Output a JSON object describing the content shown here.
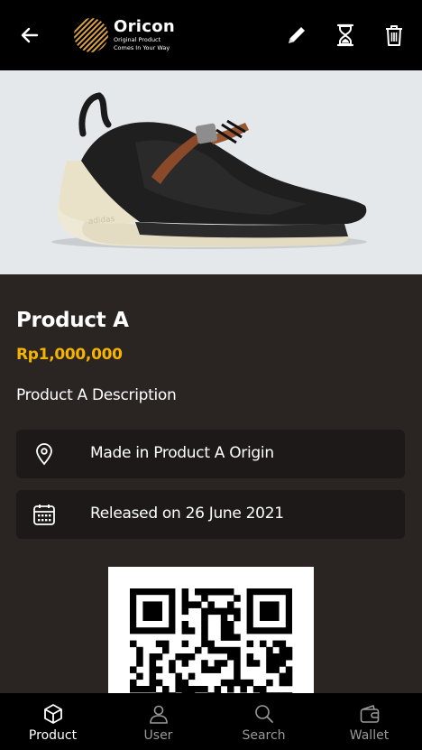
{
  "header": {
    "brand_name": "Oricon",
    "brand_tagline_1": "Original Product",
    "brand_tagline_2": "Comes In Your Way"
  },
  "product": {
    "name": "Product A",
    "price": "Rp1,000,000",
    "description": "Product A Description",
    "origin_text": "Made in Product A Origin",
    "release_text": "Released on 26 June 2021"
  },
  "nav": {
    "items": [
      {
        "label": "Product",
        "icon": "box-icon",
        "active": true
      },
      {
        "label": "User",
        "icon": "user-icon",
        "active": false
      },
      {
        "label": "Search",
        "icon": "search-icon",
        "active": false
      },
      {
        "label": "Wallet",
        "icon": "wallet-icon",
        "active": false
      }
    ]
  },
  "colors": {
    "accent": "#f5b400",
    "background": "#2a2422",
    "card": "#1c1918",
    "bar": "#000000"
  }
}
